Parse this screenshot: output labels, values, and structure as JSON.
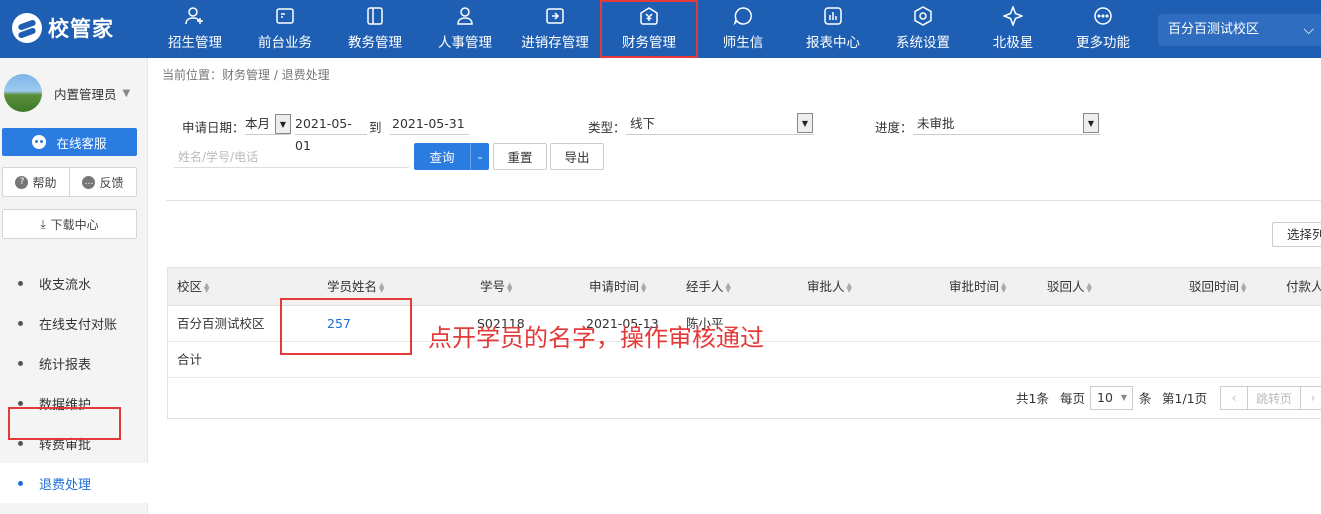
{
  "app": {
    "logo_text": "校管家"
  },
  "nav": {
    "items": [
      {
        "label": "招生管理",
        "icon": "user-plus-icon"
      },
      {
        "label": "前台业务",
        "icon": "front-desk-icon"
      },
      {
        "label": "教务管理",
        "icon": "book-icon"
      },
      {
        "label": "人事管理",
        "icon": "person-icon"
      },
      {
        "label": "进销存管理",
        "icon": "inventory-icon"
      },
      {
        "label": "财务管理",
        "icon": "finance-icon"
      },
      {
        "label": "师生信",
        "icon": "chat-icon"
      },
      {
        "label": "报表中心",
        "icon": "report-icon"
      },
      {
        "label": "系统设置",
        "icon": "settings-icon"
      },
      {
        "label": "北极星",
        "icon": "polaris-icon"
      },
      {
        "label": "更多功能",
        "icon": "more-icon"
      }
    ],
    "active_index": 5,
    "campus": "百分百测试校区"
  },
  "sidebar": {
    "user_name": "内置管理员",
    "service_label": "在线客服",
    "help_label": "帮助",
    "feedback_label": "反馈",
    "download_label": "下载中心",
    "menu": [
      {
        "label": "收支流水"
      },
      {
        "label": "在线支付对账"
      },
      {
        "label": "统计报表"
      },
      {
        "label": "数据维护"
      },
      {
        "label": "转费审批"
      },
      {
        "label": "退费处理"
      }
    ]
  },
  "breadcrumb": "当前位置：财务管理 / 退费处理",
  "filter": {
    "date_label": "申请日期：",
    "date_range_value": "本月",
    "date_from": "2021-05-01",
    "to_label": "到",
    "date_to": "2021-05-31",
    "type_label": "类型：",
    "type_value": "线下",
    "progress_label": "进度：",
    "progress_value": "未审批",
    "search_placeholder": "姓名/学号/电话",
    "query_label": "查询",
    "reset_label": "重置",
    "export_label": "导出",
    "columns_label": "选择列"
  },
  "table": {
    "headers": [
      "校区",
      "学员姓名",
      "学号",
      "申请时间",
      "经手人",
      "审批人",
      "审批时间",
      "驳回人",
      "驳回时间",
      "付款人"
    ],
    "row": {
      "campus": "百分百测试校区",
      "name": "257",
      "student_no": "S02118",
      "apply_time": "2021-05-13",
      "handler": "陈小平"
    },
    "total_label": "合计"
  },
  "pager": {
    "total": "共1条",
    "per_page_label": "每页",
    "page_size": "10",
    "unit": "条",
    "page_info": "第1/1页",
    "jump_label": "跳转页"
  },
  "annotation": "点开学员的名字，操作审核通过"
}
